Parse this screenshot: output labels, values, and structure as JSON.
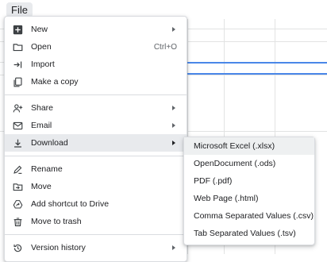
{
  "menubar": {
    "file_label": "File"
  },
  "file_menu": {
    "group1": [
      {
        "label": "New",
        "icon": "plus-box-icon",
        "submenu": true
      },
      {
        "label": "Open",
        "icon": "folder-icon",
        "shortcut": "Ctrl+O"
      },
      {
        "label": "Import",
        "icon": "import-arrow-icon"
      },
      {
        "label": "Make a copy",
        "icon": "copy-icon"
      }
    ],
    "group2": [
      {
        "label": "Share",
        "icon": "person-add-icon",
        "submenu": true
      },
      {
        "label": "Email",
        "icon": "envelope-icon",
        "submenu": true
      },
      {
        "label": "Download",
        "icon": "download-icon",
        "submenu": true
      }
    ],
    "group3": [
      {
        "label": "Rename",
        "icon": "pencil-icon"
      },
      {
        "label": "Move",
        "icon": "folder-move-icon"
      },
      {
        "label": "Add shortcut to Drive",
        "icon": "drive-shortcut-icon"
      },
      {
        "label": "Move to trash",
        "icon": "trash-icon"
      }
    ],
    "group4": [
      {
        "label": "Version history",
        "icon": "history-icon",
        "submenu": true
      }
    ]
  },
  "download_submenu": [
    "Microsoft Excel (.xlsx)",
    "OpenDocument (.ods)",
    "PDF (.pdf)",
    "Web Page (.html)",
    "Comma Separated Values (.csv)",
    "Tab Separated Values (.tsv)"
  ],
  "colors": {
    "active_bg": "#e8eaed",
    "selection_blue": "#4a87e8",
    "text": "#202124",
    "muted": "#5f6368"
  }
}
